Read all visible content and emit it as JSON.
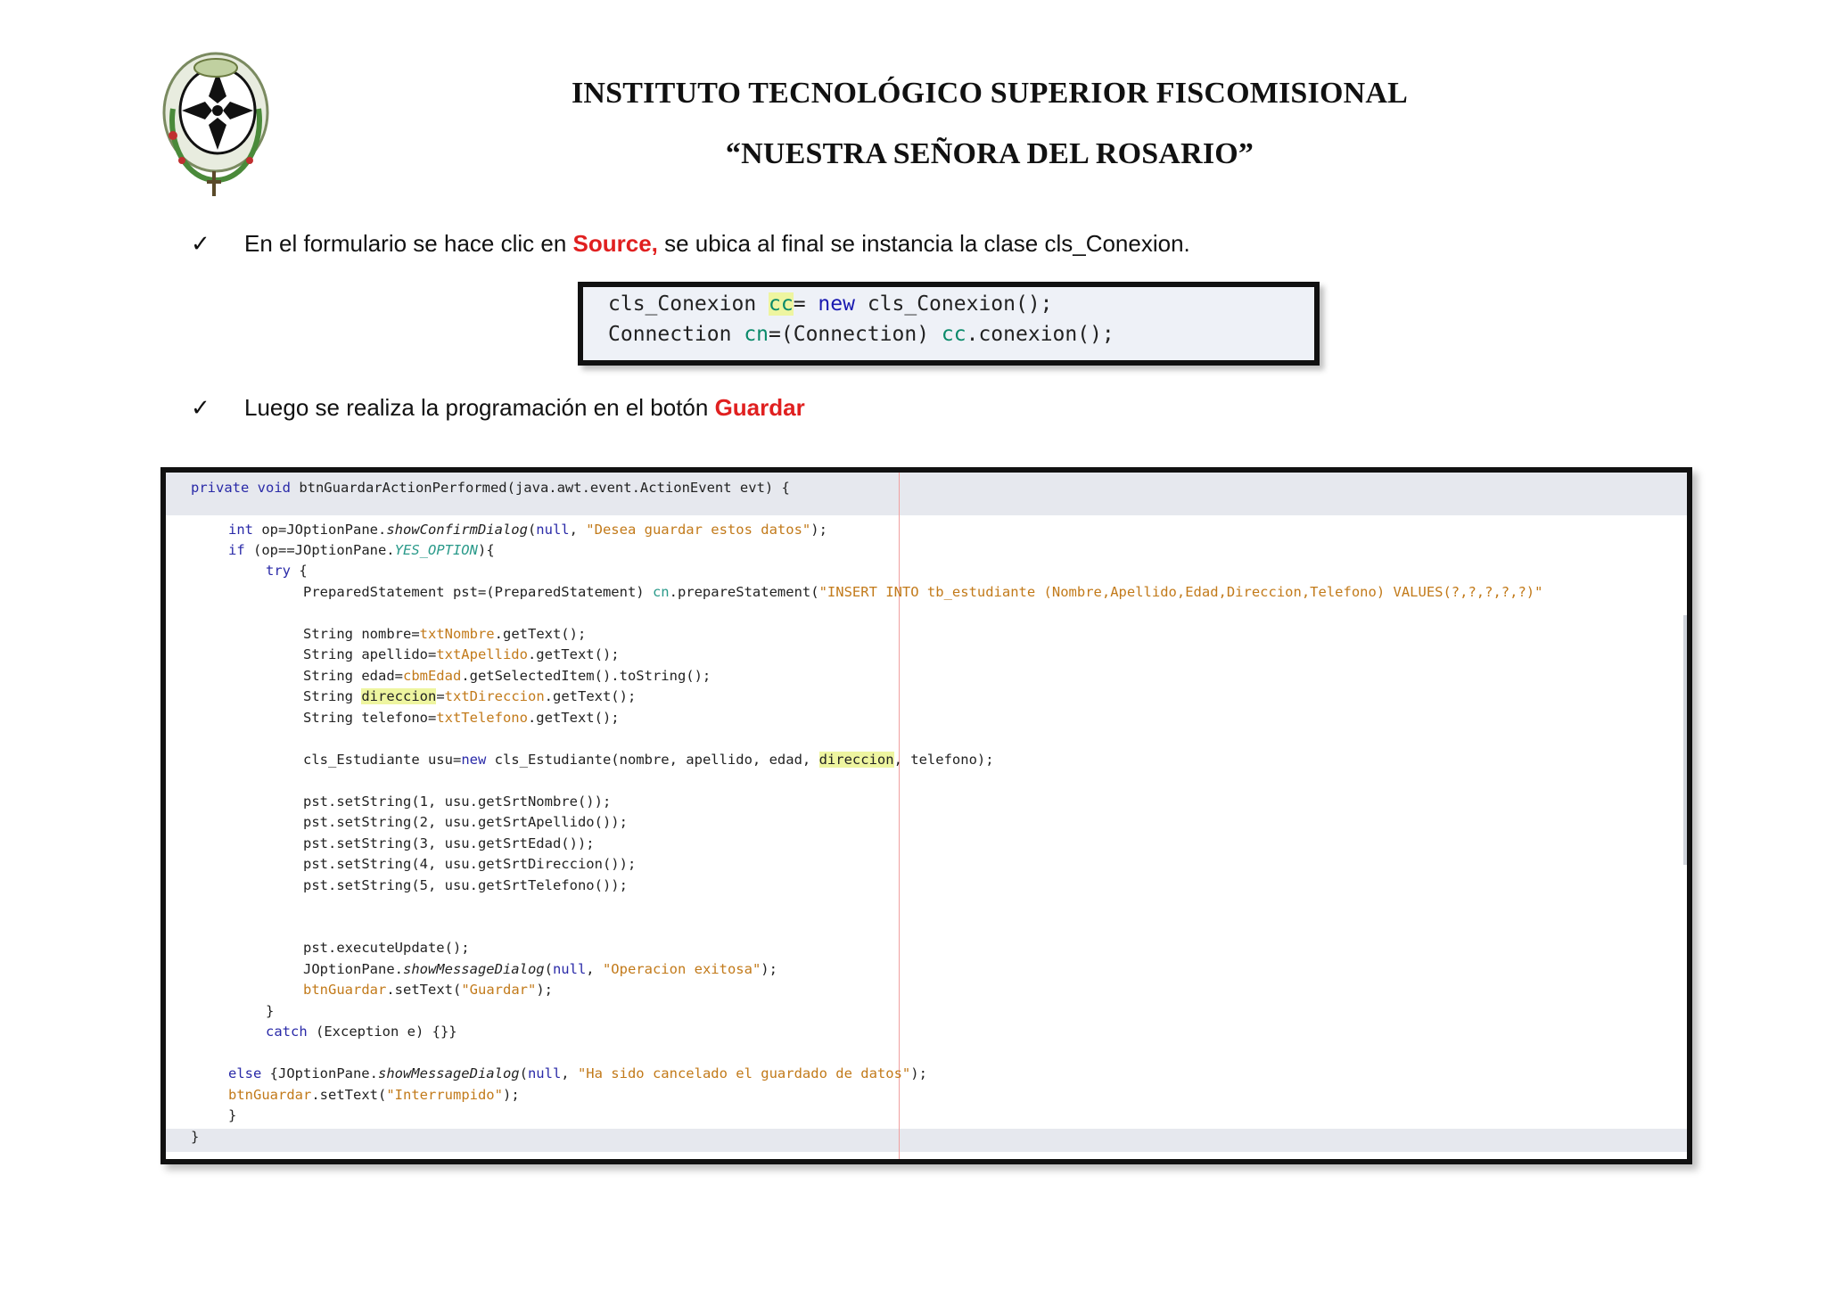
{
  "header": {
    "title_line1": "INSTITUTO TECNOLÓGICO SUPERIOR FISCOMISIONAL",
    "title_line2": "“NUESTRA SEÑORA DEL ROSARIO”",
    "logo": "crest-logo"
  },
  "bullets": [
    {
      "icon": "checkmark-icon",
      "text_before": "En el formulario se hace clic en ",
      "highlight": "Source,",
      "text_after": " se ubica al final  se instancia la clase cls_Conexion."
    },
    {
      "icon": "checkmark-icon",
      "text_before": "Luego se realiza la programación en el botón ",
      "highlight": "Guardar",
      "text_after": ""
    }
  ],
  "snippet1": {
    "line1": {
      "a": "cls_Conexion ",
      "b": "cc",
      "c": "= ",
      "d": "new",
      "e": " cls_Conexion();"
    },
    "line2": {
      "a": "Connection ",
      "b": "cn",
      "c": "=(Connection) ",
      "d": "cc",
      "e": ".conexion();"
    }
  },
  "code": {
    "l01": {
      "a": "private void",
      "b": " btnGuardarActionPerformed(java.awt.event.ActionEvent evt) {"
    },
    "l02": {
      "a": "int",
      "b": " op=JOptionPane.",
      "c": "showConfirmDialog",
      "d": "(",
      "e": "null",
      "f": ", ",
      "g": "\"Desea guardar estos datos\"",
      "h": ");"
    },
    "l03": {
      "a": "if",
      "b": " (op==JOptionPane.",
      "c": "YES_OPTION",
      "d": "){"
    },
    "l04": {
      "a": "try",
      "b": " {"
    },
    "l05": {
      "a": "PreparedStatement pst=(PreparedStatement) ",
      "b": "cn",
      "c": ".prepareStatement(",
      "d": "\"INSERT INTO tb_estudiante (Nombre,Apellido,Edad,Direccion,Telefono) VALUES(?,?,?,?,?)\""
    },
    "l06": {
      "a": "String nombre=",
      "b": "txtNombre",
      "c": ".getText();"
    },
    "l07": {
      "a": "String apellido=",
      "b": "txtApellido",
      "c": ".getText();"
    },
    "l08": {
      "a": "String edad=",
      "b": "cbmEdad",
      "c": ".getSelectedItem().toString();"
    },
    "l09": {
      "a": "String ",
      "b": "direccion",
      "c": "=",
      "d": "txtDireccion",
      "e": ".getText();"
    },
    "l10": {
      "a": "String telefono=",
      "b": "txtTelefono",
      "c": ".getText();"
    },
    "l11": {
      "a": "cls_Estudiante usu=",
      "b": "new",
      "c": " cls_Estudiante(nombre, apellido, edad, ",
      "d": "direccion",
      "e": ", telefono);"
    },
    "l12": "pst.setString(1, usu.getSrtNombre());",
    "l13": "pst.setString(2, usu.getSrtApellido());",
    "l14": "pst.setString(3, usu.getSrtEdad());",
    "l15": "pst.setString(4, usu.getSrtDireccion());",
    "l16": "pst.setString(5, usu.getSrtTelefono());",
    "l17": "pst.executeUpdate();",
    "l18": {
      "a": "JOptionPane.",
      "b": "showMessageDialog",
      "c": "(",
      "d": "null",
      "e": ", ",
      "f": "\"Operacion exitosa\"",
      "g": ");"
    },
    "l19": {
      "a": "btnGuardar",
      "b": ".setText(",
      "c": "\"Guardar\"",
      "d": ");"
    },
    "l20": "}",
    "l21": {
      "a": "catch",
      "b": " (Exception e) {}}"
    },
    "l22": {
      "a": "else",
      "b": " {JOptionPane.",
      "c": "showMessageDialog",
      "d": "(",
      "e": "null",
      "f": ", ",
      "g": "\"Ha sido cancelado el guardado de datos\"",
      "h": ");"
    },
    "l23": {
      "a": "btnGuardar",
      "b": ".setText(",
      "c": "\"Interrumpido\"",
      "d": ");"
    },
    "l24": "}",
    "l25": "}"
  }
}
